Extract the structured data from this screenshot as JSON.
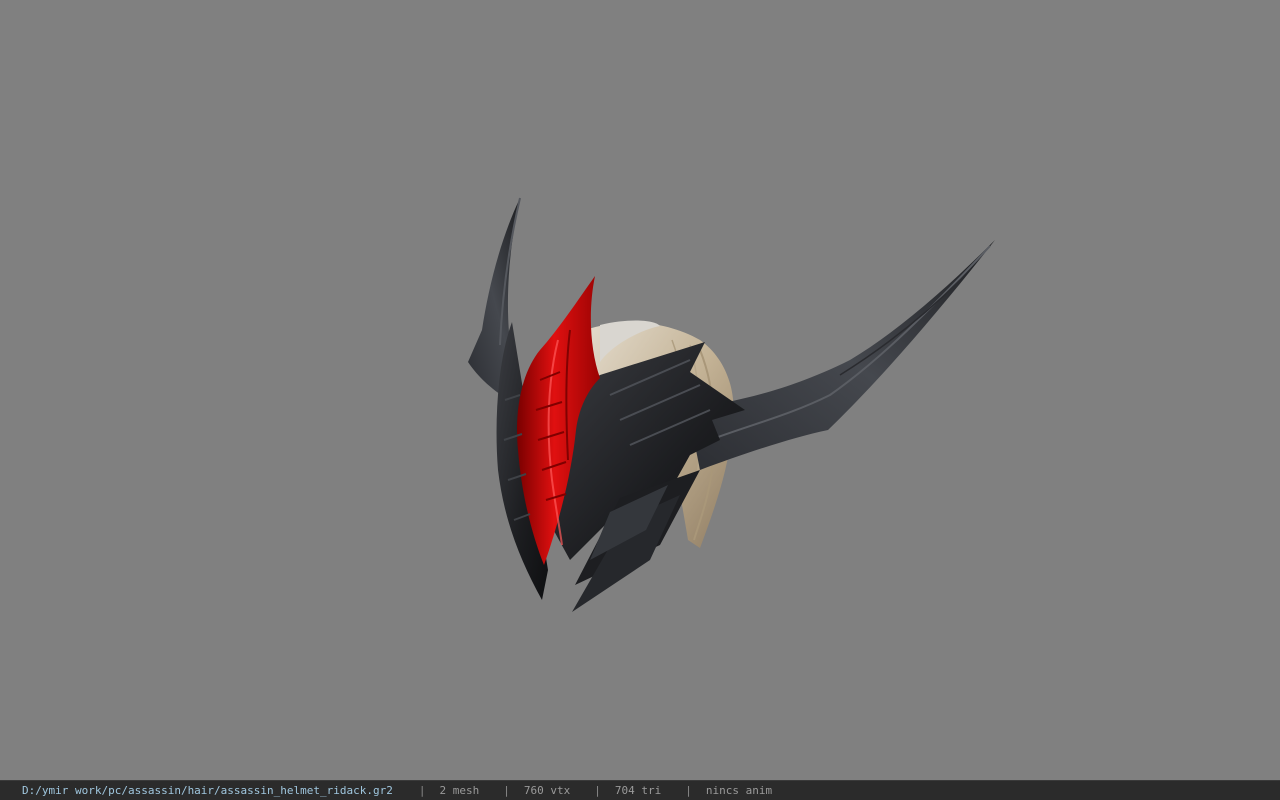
{
  "viewer": {
    "background_color": "#808080",
    "model_name": "assassin helmet ridack"
  },
  "status_bar": {
    "file_path": "D:/ymir work/pc/assassin/hair/assassin_helmet_ridack.gr2",
    "separator": "|",
    "mesh_count": "2 mesh",
    "vertex_count": "760 vtx",
    "triangle_count": "704 tri",
    "animation": "nincs anim"
  },
  "colors": {
    "status_bar_bg": "#2b2b2b",
    "path_text": "#9fc6de",
    "stat_text": "#9a9a9a",
    "armor_dark": "#1e1f22",
    "armor_red": "#d10a0a",
    "hair": "#cdbfa8"
  }
}
